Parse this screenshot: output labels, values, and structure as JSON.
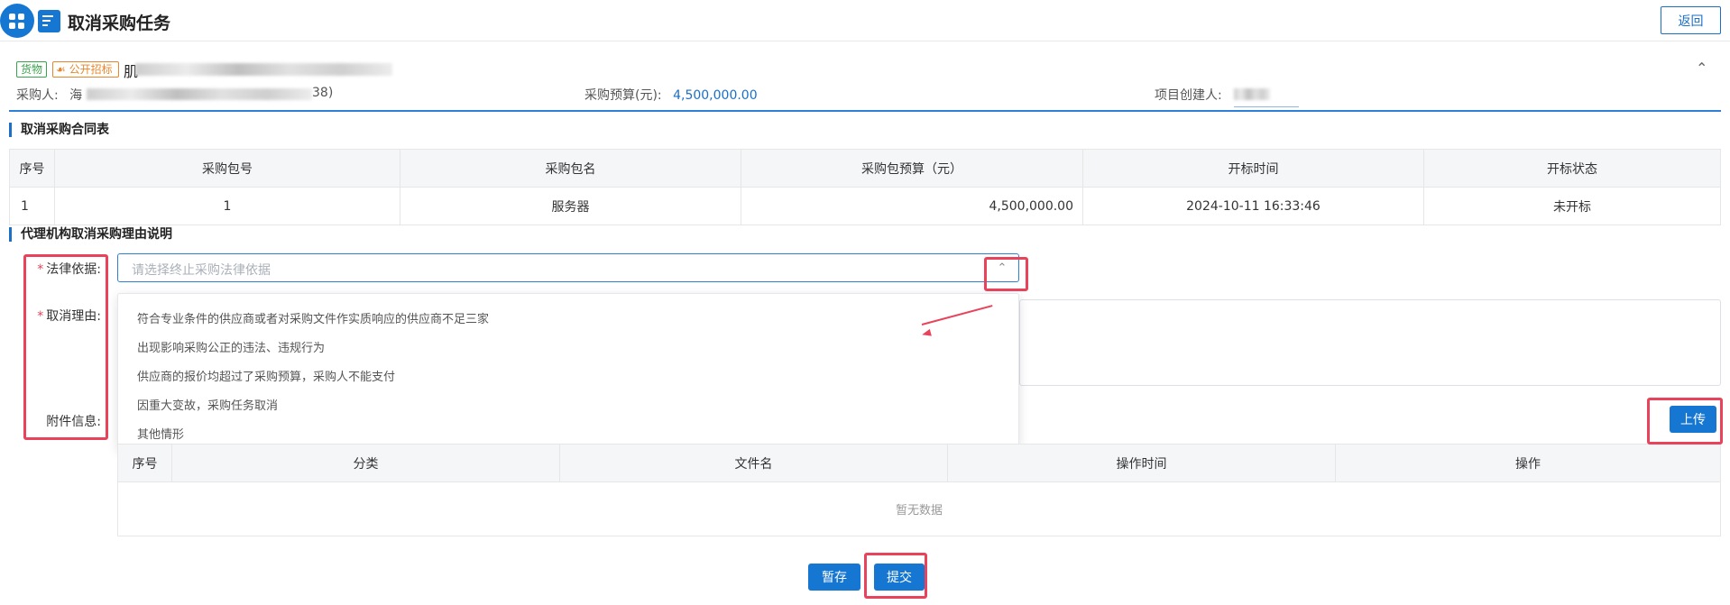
{
  "header": {
    "title": "取消采购任务",
    "back_label": "返回"
  },
  "project": {
    "tag_goods": "货物",
    "tag_method": "公开招标",
    "name_visible": "肌",
    "purchaser_label": "采购人:",
    "purchaser_prefix": "海",
    "purchaser_suffix": "38)",
    "budget_label": "采购预算(元):",
    "budget_value": "4,500,000.00",
    "creator_label": "项目创建人:"
  },
  "contract_section": {
    "title": "取消采购合同表",
    "columns": [
      "序号",
      "采购包号",
      "采购包名",
      "采购包预算（元）",
      "开标时间",
      "开标状态"
    ],
    "rows": [
      {
        "index": "1",
        "package_no": "1",
        "package_name": "服务器",
        "budget": "4,500,000.00",
        "open_time": "2024-10-11 16:33:46",
        "status": "未开标"
      }
    ]
  },
  "reason_section": {
    "title": "代理机构取消采购理由说明",
    "legal_basis_label": "法律依据:",
    "legal_basis_placeholder": "请选择终止采购法律依据",
    "cancel_reason_label": "取消理由:",
    "attachment_label": "附件信息:",
    "required_mark": "*",
    "dropdown_options": [
      "符合专业条件的供应商或者对采购文件作实质响应的供应商不足三家",
      "出现影响采购公正的违法、违规行为",
      "供应商的报价均超过了采购预算，采购人不能支付",
      "因重大变故，采购任务取消",
      "其他情形"
    ],
    "upload_label": "上传"
  },
  "attachment_table": {
    "columns": [
      "序号",
      "分类",
      "文件名",
      "操作时间",
      "操作"
    ],
    "empty_text": "暂无数据"
  },
  "footer": {
    "save_label": "暂存",
    "submit_label": "提交"
  },
  "icons": {
    "collapse": "chevron-up-icon",
    "select_arrow": "chevron-up-icon"
  }
}
